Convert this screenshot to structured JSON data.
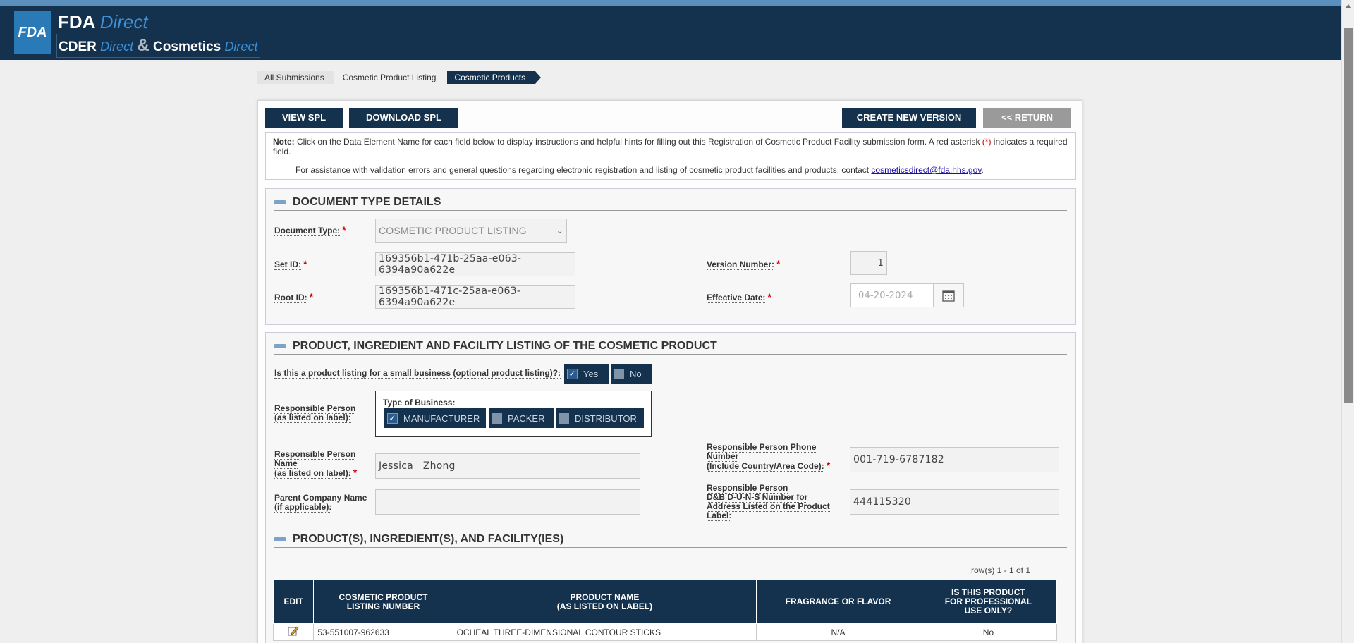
{
  "header": {
    "logo": "FDA",
    "brand_fda": "FDA",
    "brand_direct": "Direct",
    "brand_cder": "CDER",
    "brand_cder_direct": "Direct",
    "brand_amp": "&",
    "brand_cosmetics": "Cosmetics",
    "brand_cosmetics_direct": "Direct"
  },
  "breadcrumb": [
    "All Submissions",
    "Cosmetic Product Listing",
    "Cosmetic Products"
  ],
  "toolbar": {
    "view_spl": "VIEW SPL",
    "download_spl": "DOWNLOAD SPL",
    "create_new_version": "CREATE NEW VERSION",
    "return": "<< RETURN"
  },
  "note": {
    "prefix": "Note:",
    "text1": " Click on the Data Element Name for each field below to display instructions and helpful hints for filling out this Registration of Cosmetic Product Facility submission form. A red asterisk ",
    "asterisk": "(*)",
    "text2": " indicates a required field.",
    "assist": "For assistance with validation errors and general questions regarding electronic registration and listing of cosmetic product facilities and products, contact ",
    "email": "cosmeticsdirect@fda.hhs.gov",
    "period": "."
  },
  "doc_type": {
    "title": "DOCUMENT TYPE DETAILS",
    "document_type_label": "Document Type:",
    "document_type_value": "COSMETIC PRODUCT LISTING",
    "set_id_label": "Set ID:",
    "set_id_value": "169356b1-471b-25aa-e063-6394a90a622e",
    "root_id_label": "Root ID:",
    "root_id_value": "169356b1-471c-25aa-e063-6394a90a622e",
    "version_label": "Version Number:",
    "version_value": "1",
    "effective_date_label": "Effective Date:",
    "effective_date_value": "04-20-2024"
  },
  "listing": {
    "title": "PRODUCT, INGREDIENT AND FACILITY LISTING OF THE COSMETIC PRODUCT",
    "small_business_label": "Is this a product listing for a small business (optional product listing)?:",
    "yes": "Yes",
    "no": "No",
    "responsible_person_label_1": "Responsible Person",
    "responsible_person_label_2": "(as listed on label):",
    "type_of_business": "Type of Business:",
    "manufacturer": "MANUFACTURER",
    "packer": "PACKER",
    "distributor": "DISTRIBUTOR",
    "rp_name_label_1": "Responsible Person",
    "rp_name_label_2": "Name",
    "rp_name_label_3": "(as listed on label):",
    "rp_name_value": "Jessica   Zhong",
    "phone_label_1": "Responsible Person Phone",
    "phone_label_2": "Number",
    "phone_label_3": "(Include Country/Area Code):",
    "phone_value": "001-719-6787182",
    "parent_label_1": "Parent Company Name",
    "parent_label_2": "(if applicable):",
    "parent_value": "",
    "duns_label_1": "Responsible Person",
    "duns_label_2": "D&B D-U-N-S Number for",
    "duns_label_3": "Address Listed on the Product",
    "duns_label_4": "Label:",
    "duns_value": "444115320"
  },
  "products": {
    "title": "PRODUCT(S), INGREDIENT(S), AND FACILITY(IES)",
    "row_count": "row(s) 1 - 1 of 1",
    "columns": [
      "EDIT",
      "COSMETIC PRODUCT LISTING NUMBER",
      "PRODUCT NAME (AS LISTED ON LABEL)",
      "FRAGRANCE OR FLAVOR",
      "IS THIS PRODUCT FOR PROFESSIONAL USE ONLY?"
    ],
    "col_lines": {
      "c1a": "COSMETIC PRODUCT",
      "c1b": "LISTING NUMBER",
      "c2a": "PRODUCT NAME",
      "c2b": "(AS LISTED ON LABEL)",
      "c4a": "IS THIS PRODUCT",
      "c4b": "FOR PROFESSIONAL",
      "c4c": "USE ONLY?"
    },
    "rows": [
      {
        "listing_number": "53-551007-962633",
        "product_name": "OCHEAL THREE-DIMENSIONAL CONTOUR STICKS",
        "fragrance": "N/A",
        "professional": "No"
      }
    ]
  }
}
